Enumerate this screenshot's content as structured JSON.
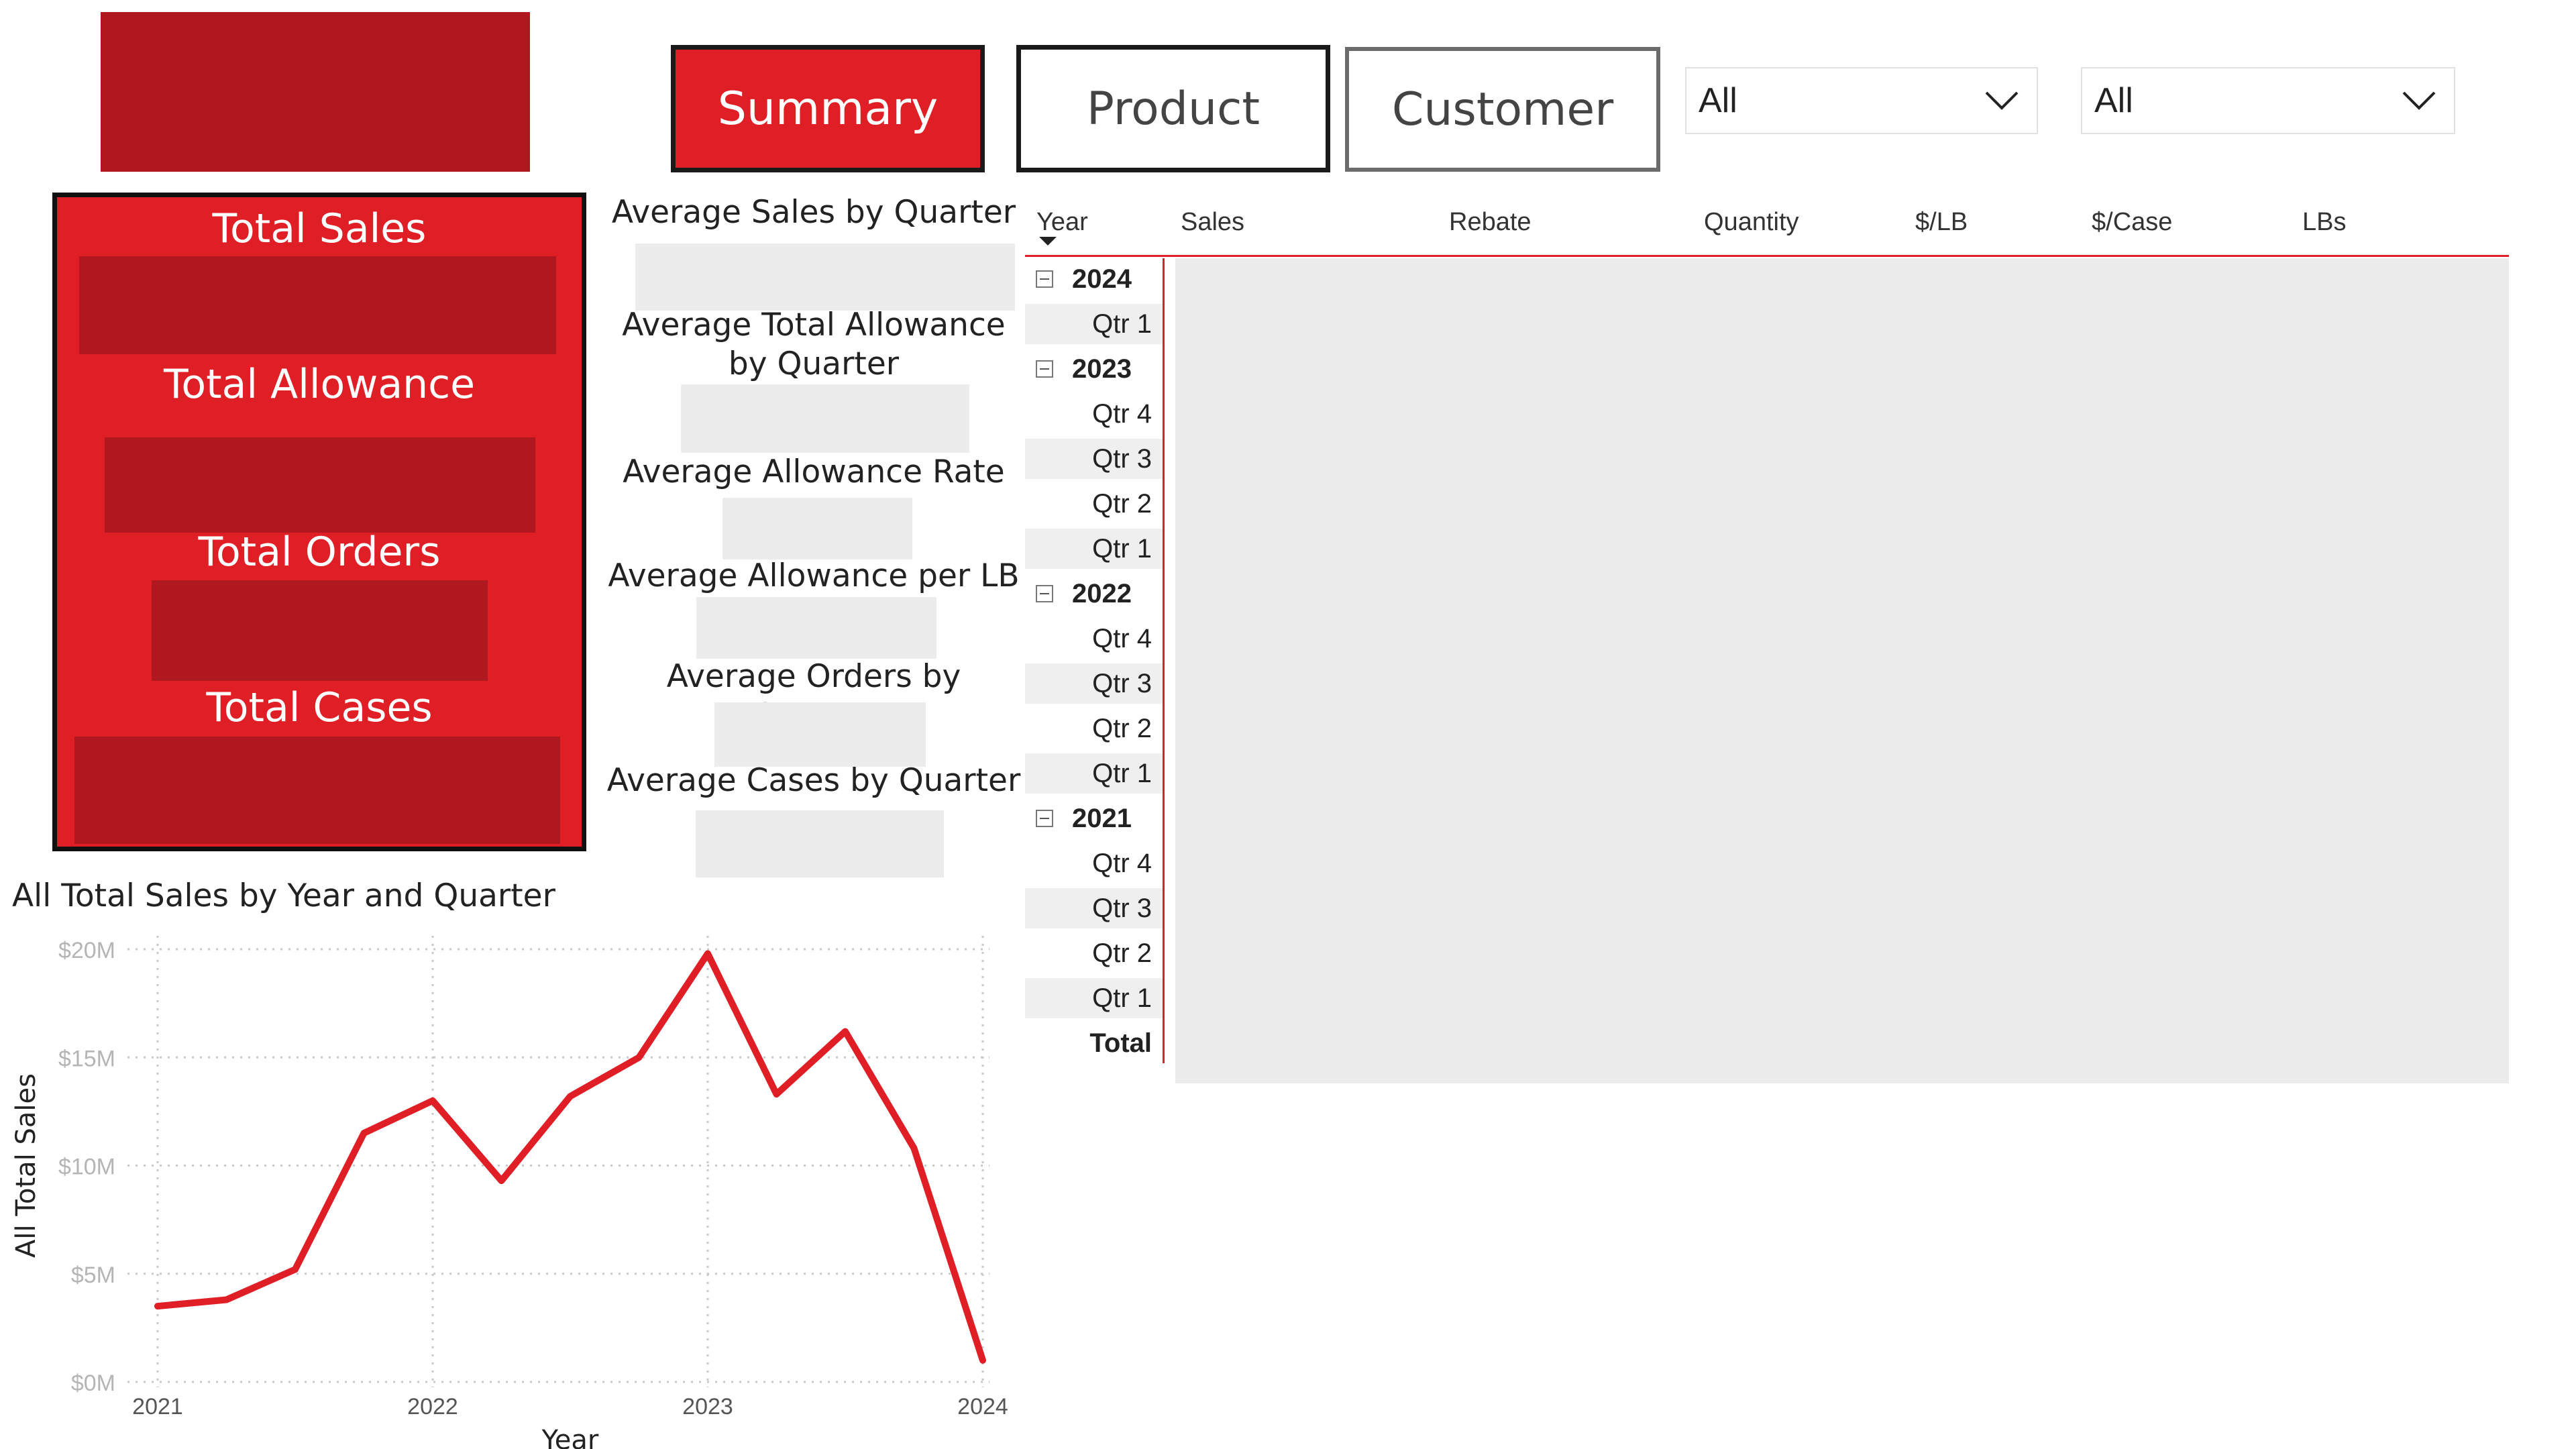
{
  "logo": {
    "color": "#b0181f"
  },
  "nav": {
    "summary": "Summary",
    "product": "Product",
    "customer": "Customer",
    "active": "summary"
  },
  "filters": [
    {
      "value": "All",
      "icon": "chevron-down-icon"
    },
    {
      "value": "All",
      "icon": "chevron-down-icon"
    }
  ],
  "kpis": {
    "total_sales": "Total Sales",
    "total_allowance": "Total Allowance",
    "total_orders": "Total Orders",
    "total_cases": "Total Cases"
  },
  "averages": {
    "sales_by_quarter": "Average Sales by Quarter",
    "total_allowance_by_quarter_line1": "Average Total Allowance",
    "total_allowance_by_quarter_line2": "by Quarter",
    "allowance_rate": "Average Allowance Rate",
    "allowance_per_lb": "Average Allowance per LB",
    "orders_by_quarter": "Average Orders by Quarter",
    "cases_by_quarter": "Average Cases by Quarter"
  },
  "matrix": {
    "columns": [
      "Year",
      "Sales",
      "Rebate",
      "Quantity",
      "$/LB",
      "$/Case",
      "LBs"
    ],
    "rows": [
      {
        "type": "year",
        "label": "2024"
      },
      {
        "type": "qtr",
        "label": "Qtr 1"
      },
      {
        "type": "year",
        "label": "2023"
      },
      {
        "type": "qtr",
        "label": "Qtr 4"
      },
      {
        "type": "qtr",
        "label": "Qtr 3"
      },
      {
        "type": "qtr",
        "label": "Qtr 2"
      },
      {
        "type": "qtr",
        "label": "Qtr 1"
      },
      {
        "type": "year",
        "label": "2022"
      },
      {
        "type": "qtr",
        "label": "Qtr 4"
      },
      {
        "type": "qtr",
        "label": "Qtr 3"
      },
      {
        "type": "qtr",
        "label": "Qtr 2"
      },
      {
        "type": "qtr",
        "label": "Qtr 1"
      },
      {
        "type": "year",
        "label": "2021"
      },
      {
        "type": "qtr",
        "label": "Qtr 4"
      },
      {
        "type": "qtr",
        "label": "Qtr 3"
      },
      {
        "type": "qtr",
        "label": "Qtr 2"
      },
      {
        "type": "qtr",
        "label": "Qtr 1"
      },
      {
        "type": "total",
        "label": "Total"
      }
    ],
    "accent": "#e01e26"
  },
  "chart_data": {
    "type": "line",
    "title": "All Total Sales by Year and Quarter",
    "xlabel": "Year",
    "ylabel": "All Total Sales",
    "x_ticks": [
      "2021",
      "2022",
      "2023",
      "2024"
    ],
    "ylim": [
      0,
      20
    ],
    "y_unit": "$M",
    "series": [
      {
        "x": [
          2021.0,
          2021.25,
          2021.5,
          2021.75,
          2022.0,
          2022.25,
          2022.5,
          2022.75,
          2023.0,
          2023.25,
          2023.5,
          2023.75,
          2024.0
        ],
        "values": [
          3.5,
          3.8,
          5.2,
          11.5,
          13.0,
          9.3,
          13.2,
          15.0,
          19.8,
          13.3,
          16.2,
          10.8,
          1.0
        ],
        "color": "#e01e26"
      }
    ],
    "grid": true
  }
}
